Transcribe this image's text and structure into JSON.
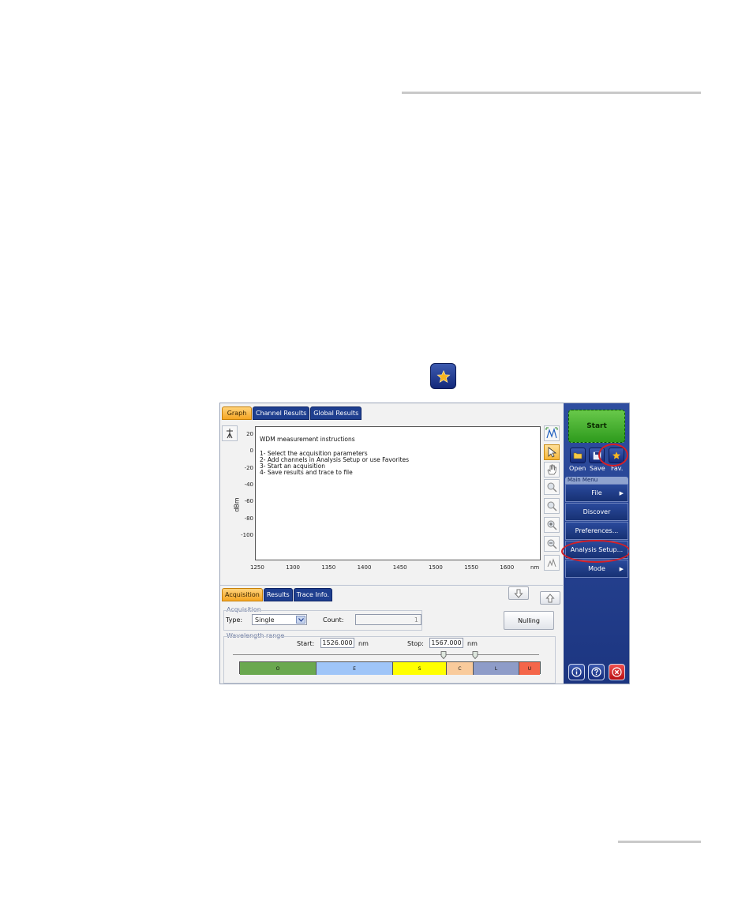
{
  "screenshot": {
    "graph_tabs": [
      "Graph",
      "Channel Results",
      "Global Results"
    ],
    "instructions": [
      "WDM measurement instructions",
      "1- Select the acquisition parameters",
      "2- Add channels in Analysis Setup or use Favorites",
      "3- Start an acquisition",
      "4- Save results and trace to file"
    ],
    "y_axis_label": "dBm",
    "x_axis_unit": "nm",
    "y_ticks": [
      "20",
      "0",
      "-20",
      "-40",
      "-60",
      "-80",
      "-100"
    ],
    "x_ticks": [
      "1250",
      "1300",
      "1350",
      "1400",
      "1450",
      "1500",
      "1550",
      "1600"
    ],
    "sidebar": {
      "start_label": "Start",
      "quick_buttons": [
        "Open",
        "Save",
        "Fav."
      ],
      "main_menu_label": "Main Menu",
      "menu_items": [
        "File",
        "Discover",
        "Preferences...",
        "Analysis Setup...",
        "Mode"
      ]
    },
    "bottom_tabs": [
      "Acquisition",
      "Results",
      "Trace Info."
    ],
    "acquisition": {
      "group_label": "Acquisition",
      "type_label": "Type:",
      "type_value": "Single",
      "count_label": "Count:",
      "count_value": "1",
      "nulling_label": "Nulling"
    },
    "wavelength": {
      "group_label": "Wavelength range",
      "start_label": "Start:",
      "start_value": "1526.000",
      "stop_label": "Stop:",
      "stop_value": "1567.000",
      "unit": "nm"
    },
    "bands": [
      {
        "label": "O",
        "color": "#6aa84f"
      },
      {
        "label": "E",
        "color": "#9fc5f8"
      },
      {
        "label": "S",
        "color": "#ffff00"
      },
      {
        "label": "C",
        "color": "#f9cb9c"
      },
      {
        "label": "L",
        "color": "#8e9cc8"
      },
      {
        "label": "U",
        "color": "#f4664a"
      }
    ]
  },
  "colors": {
    "sidebar_blue": "#1c3580",
    "tab_active": "#f5a623",
    "start_green": "#3aa526",
    "highlight_red": "#d51f26"
  }
}
